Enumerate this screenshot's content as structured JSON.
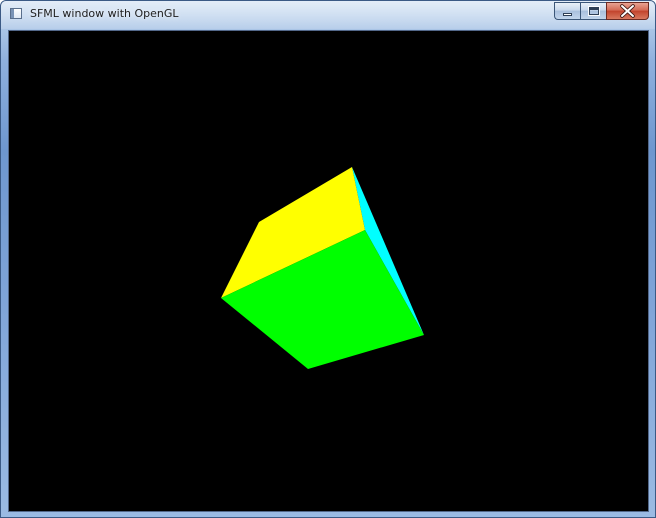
{
  "window": {
    "title": "SFML window with OpenGL",
    "icon": "app-window-icon"
  },
  "caption_buttons": {
    "minimize": {
      "icon": "minimize-icon"
    },
    "maximize": {
      "icon": "maximize-icon"
    },
    "close": {
      "icon": "close-icon"
    }
  },
  "viewport": {
    "background": "#000000",
    "cube": {
      "faces": [
        {
          "name": "top-face",
          "color": "#ffff00"
        },
        {
          "name": "front-face",
          "color": "#00ff00"
        },
        {
          "name": "side-face",
          "color": "#00ffff"
        }
      ]
    }
  }
}
